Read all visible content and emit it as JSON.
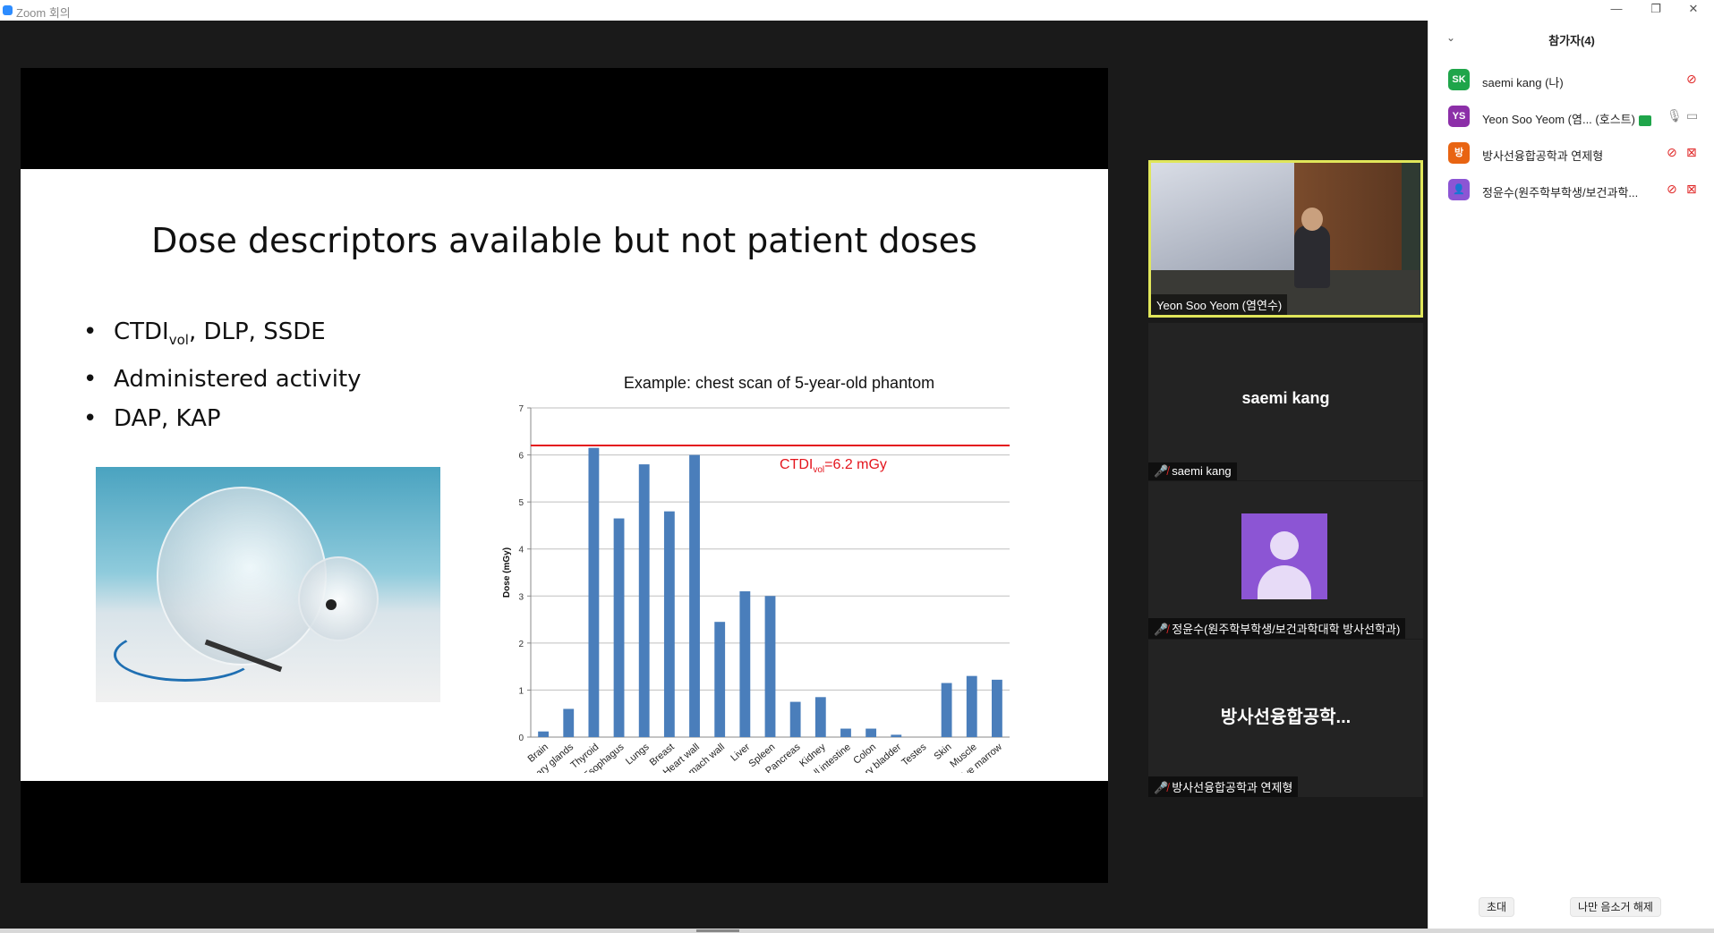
{
  "window": {
    "title": "Zoom 회의",
    "minimize": "—",
    "restore": "❐",
    "close": "✕"
  },
  "slide": {
    "title": "Dose descriptors available but not patient doses",
    "bullets": [
      {
        "main": "CTDI",
        "sub": "vol",
        "rest": ", DLP, SSDE"
      },
      {
        "main": "Administered activity"
      },
      {
        "main": "DAP, KAP"
      }
    ]
  },
  "chart_data": {
    "type": "bar",
    "title": "Example: chest scan of 5-year-old phantom",
    "ylabel": "Dose (mGy)",
    "ylim": [
      0,
      7
    ],
    "yticks": [
      0,
      1,
      2,
      3,
      4,
      5,
      6,
      7
    ],
    "categories": [
      "Brain",
      "Salivary glands",
      "Thyroid",
      "Esophagus",
      "Lungs",
      "Breast",
      "Heart wall",
      "Stomach wall",
      "Liver",
      "Spleen",
      "Pancreas",
      "Kidney",
      "Small intestine",
      "Colon",
      "Urinary bladder",
      "Testes",
      "Skin",
      "Muscle",
      "Active marrow"
    ],
    "values": [
      0.12,
      0.6,
      6.15,
      4.65,
      5.8,
      4.8,
      6.0,
      2.45,
      3.1,
      3.0,
      0.75,
      0.85,
      0.18,
      0.18,
      0.05,
      0.0,
      1.15,
      1.3,
      1.22
    ],
    "reference_line": {
      "value": 6.2,
      "label_main": "CTDI",
      "label_sub": "vol",
      "label_rest": "=6.2 mGy",
      "color": "#e4141c"
    },
    "bar_color": "#4a7ebb"
  },
  "tiles": [
    {
      "label": "Yeon Soo Yeom (염연수)",
      "active": true
    },
    {
      "name": "saemi kang",
      "label": "saemi kang",
      "muted": true
    },
    {
      "label": "정윤수(원주학부학생/보건과학대학 방사선학과)",
      "muted": true,
      "avatar": true
    },
    {
      "name": "방사선융합공학...",
      "label": "방사선융합공학과 연제형",
      "muted": true
    }
  ],
  "participants": {
    "header": "참가자(4)",
    "items": [
      {
        "initials": "SK",
        "color": "#1fa54a",
        "name": "saemi kang (나)"
      },
      {
        "initials": "YS",
        "color": "#8c2fa8",
        "name": "Yeon Soo Yeom (염... (호스트)"
      },
      {
        "initials": "방",
        "color": "#e86412",
        "name": "방사선융합공학과 연제형"
      },
      {
        "initials": "",
        "color": "#8c55d4",
        "name": "정윤수(원주학부학생/보건과학..."
      }
    ],
    "invite_label": "초대",
    "unmute_label": "나만 음소거 해제"
  }
}
